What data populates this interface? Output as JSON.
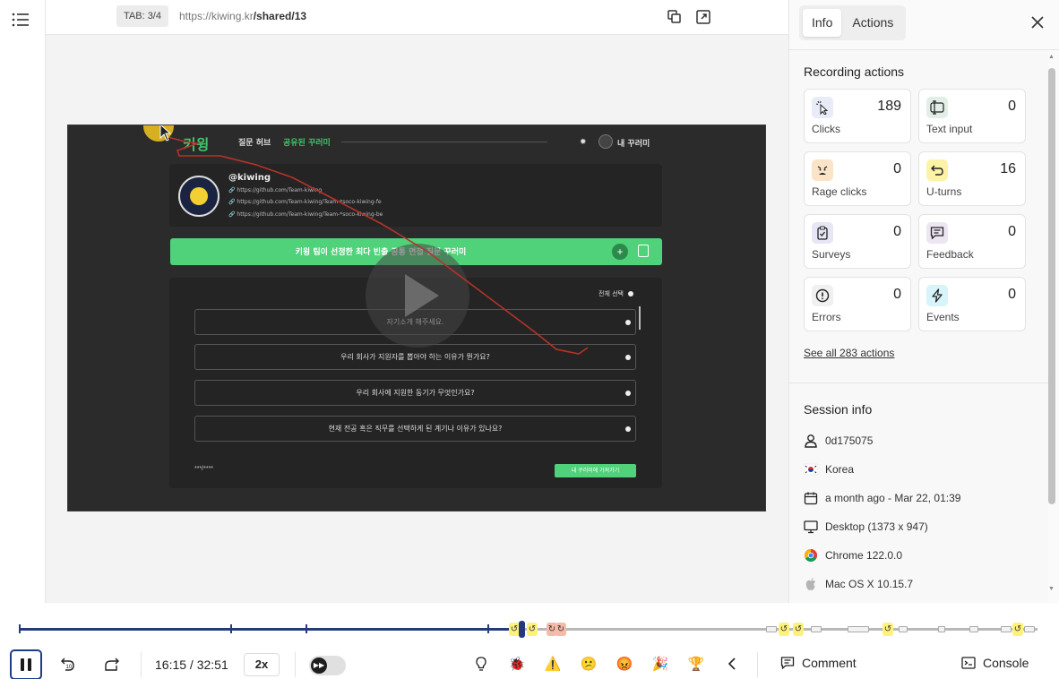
{
  "topbar": {
    "tab_badge": "TAB: 3/4",
    "url_host": "https://kiwing.kr",
    "url_path": "/shared/13"
  },
  "replay": {
    "logo": "키윙",
    "nav_questions": "질문 허브",
    "nav_shared": "공유된 꾸러미",
    "nav_mine": "내 꾸러미",
    "handle": "@kiwing",
    "links": [
      "https://github.com/Team-kiwing",
      "https://github.com/Team-kiwing/Team-*soco-kiwing-fe",
      "https://github.com/Team-kiwing/Team-*soco-kiwing-be"
    ],
    "bundle_title": "키윙 팀이 선정한 최다 빈출 공통 면접 질문 꾸러미",
    "select_all": "전체 선택",
    "questions": [
      "자기소개 해주세요.",
      "우리 회사가 지원자를 뽑아야 하는 이유가 뭔가요?",
      "우리 회사에 지원한 동기가 무엇인가요?",
      "현재 전공 혹은 직무를 선택하게 된 계기나 이유가 있나요?"
    ],
    "pager": "***/****",
    "import_button": "내 꾸러미에 가져가기"
  },
  "panel": {
    "tabs": [
      "Info",
      "Actions"
    ],
    "active_tab": "Info",
    "recording_title": "Recording actions",
    "actions": [
      {
        "label": "Clicks",
        "count": "189",
        "icon": "cursor-click-icon",
        "color": "#e8ecf8"
      },
      {
        "label": "Text input",
        "count": "0",
        "icon": "text-input-icon",
        "color": "#e3efe6"
      },
      {
        "label": "Rage clicks",
        "count": "0",
        "icon": "angry-face-icon",
        "color": "#fbe3c8"
      },
      {
        "label": "U-turns",
        "count": "16",
        "icon": "u-turn-icon",
        "color": "#fdf3a6"
      },
      {
        "label": "Surveys",
        "count": "0",
        "icon": "clipboard-icon",
        "color": "#e6e6f5"
      },
      {
        "label": "Feedback",
        "count": "0",
        "icon": "feedback-icon",
        "color": "#ece6f3"
      },
      {
        "label": "Errors",
        "count": "0",
        "icon": "error-icon",
        "color": "#f0f0f0"
      },
      {
        "label": "Events",
        "count": "0",
        "icon": "lightning-icon",
        "color": "#d6f4fa"
      }
    ],
    "see_all": "See all 283 actions",
    "session_title": "Session info",
    "session": [
      {
        "icon": "user-icon",
        "text": "0d175075"
      },
      {
        "icon": "korea-flag-icon",
        "text": "Korea"
      },
      {
        "icon": "calendar-icon",
        "text": "a month ago - Mar 22, 01:39"
      },
      {
        "icon": "desktop-icon",
        "text": "Desktop (1373 x 947)"
      },
      {
        "icon": "chrome-icon",
        "text": "Chrome 122.0.0"
      },
      {
        "icon": "apple-icon",
        "text": "Mac OS X 10.15.7"
      }
    ]
  },
  "controls": {
    "time": "16:15 / 32:51",
    "speed": "2x",
    "comment": "Comment",
    "console": "Console"
  }
}
